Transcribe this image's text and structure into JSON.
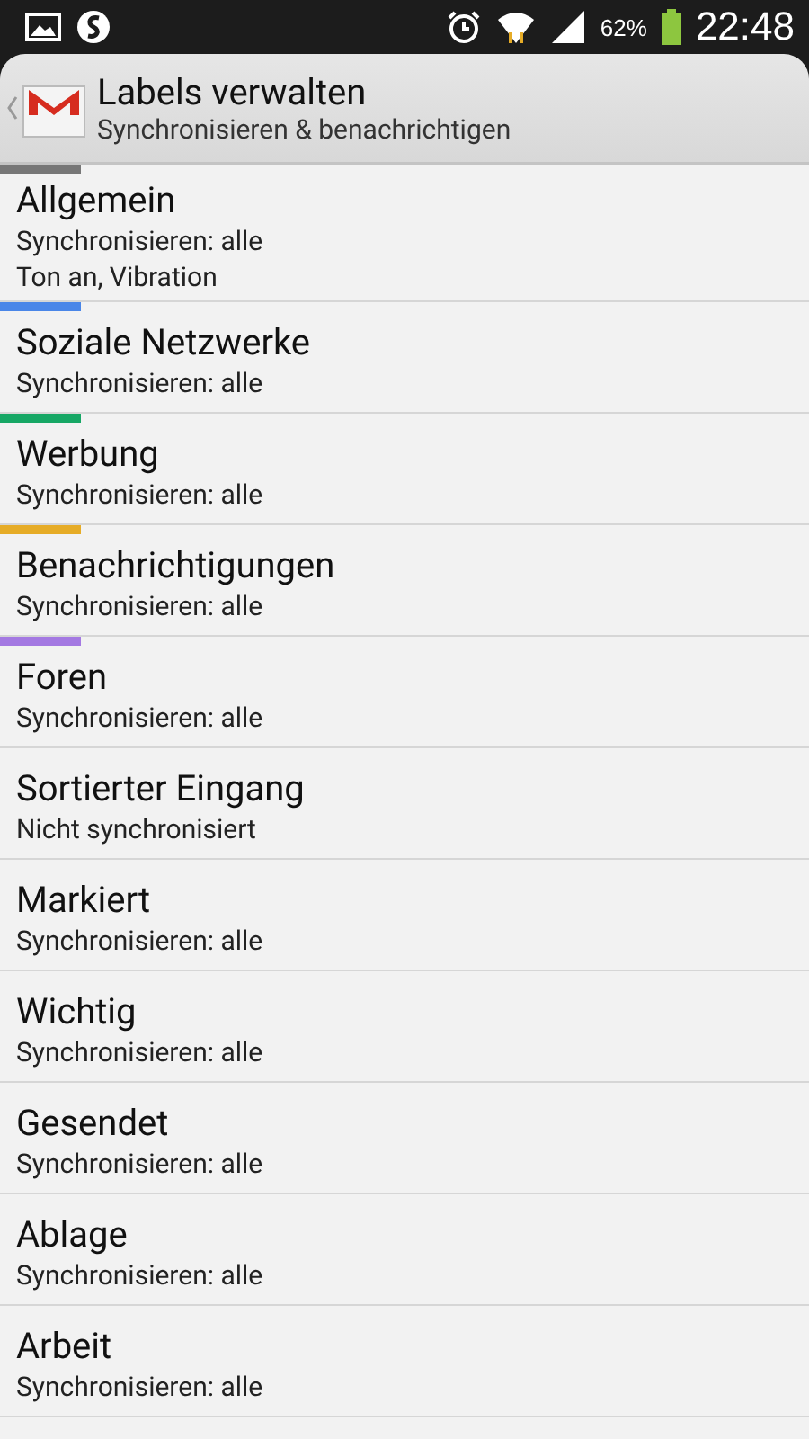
{
  "status_bar": {
    "battery": "62%",
    "time": "22:48"
  },
  "action_bar": {
    "title": "Labels verwalten",
    "subtitle": "Synchronisieren & benachrichtigen"
  },
  "labels": [
    {
      "name": "Allgemein",
      "lines": [
        "Synchronisieren: alle",
        "Ton an, Vibration"
      ],
      "color": "#777777"
    },
    {
      "name": "Soziale Netzwerke",
      "lines": [
        "Synchronisieren: alle"
      ],
      "color": "#4a86e8"
    },
    {
      "name": "Werbung",
      "lines": [
        "Synchronisieren: alle"
      ],
      "color": "#16a765"
    },
    {
      "name": "Benachrichtigungen",
      "lines": [
        "Synchronisieren: alle"
      ],
      "color": "#e6ac27"
    },
    {
      "name": "Foren",
      "lines": [
        "Synchronisieren: alle"
      ],
      "color": "#a479e2"
    },
    {
      "name": "Sortierter Eingang",
      "lines": [
        "Nicht synchronisiert"
      ]
    },
    {
      "name": "Markiert",
      "lines": [
        "Synchronisieren: alle"
      ]
    },
    {
      "name": "Wichtig",
      "lines": [
        "Synchronisieren: alle"
      ]
    },
    {
      "name": "Gesendet",
      "lines": [
        "Synchronisieren: alle"
      ]
    },
    {
      "name": "Ablage",
      "lines": [
        "Synchronisieren: alle"
      ]
    },
    {
      "name": "Arbeit",
      "lines": [
        "Synchronisieren: alle"
      ]
    }
  ]
}
